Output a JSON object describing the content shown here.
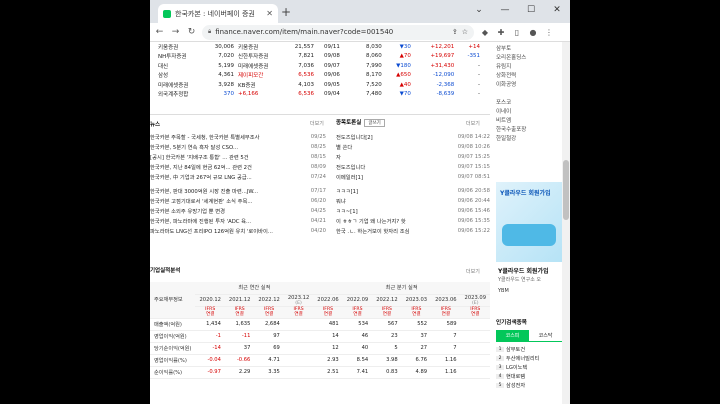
{
  "browser": {
    "tab_title": "한국카본 : 네이버페이 증권",
    "url": "finance.naver.com/item/main.naver?code=001540"
  },
  "quote_table": [
    [
      "키움증권",
      "30,006",
      "키움증권",
      "21,557"
    ],
    [
      "NH투자증권",
      "7,020",
      "신한투자증권",
      "7,821"
    ],
    [
      "대신",
      "5,199",
      "미래에셋증권",
      "7,036"
    ],
    [
      "삼성",
      "4,361",
      "제이피모간",
      "6,536"
    ],
    [
      "미래에셋증권",
      "3,928",
      "KB증권",
      "4,103"
    ],
    [
      "외국계추정합",
      "370",
      "+6,166",
      "6,536"
    ]
  ],
  "daily_table": [
    [
      "09/11",
      "8,030",
      "▼30",
      "+12,201",
      "+14"
    ],
    [
      "09/08",
      "8,060",
      "▲70",
      "+19,697",
      "-351"
    ],
    [
      "09/07",
      "7,990",
      "▼180",
      "+31,430",
      "-"
    ],
    [
      "09/06",
      "8,170",
      "▲650",
      "-12,090",
      "-"
    ],
    [
      "09/05",
      "7,520",
      "▲40",
      "-2,368",
      "-"
    ],
    [
      "09/04",
      "7,480",
      "▼70",
      "-8,639",
      "-"
    ]
  ],
  "news": {
    "title": "뉴스",
    "more": "더보기",
    "items": [
      {
        "t": "한국카본 주목할 - 국세청, 한국카본 특별세무조사",
        "d": "09/25"
      },
      {
        "t": "한국카본, 5분기 연속 흑자 달성 CSO...",
        "d": "08/25"
      },
      {
        "t": "[공시] 한국카본 '지배구조 통합' ... 관련 5건",
        "d": "08/15"
      },
      {
        "t": "한국카본, 지난 84일에 현금 62억... 관련 2건",
        "d": "08/09"
      },
      {
        "t": "한국카본, 中 기업과 267억 규모 LNG 공급...",
        "d": "07/24"
      },
      {
        "t": "한국카본, 판대 3000억원 시장 진출 마련...JW...",
        "d": "07/17"
      },
      {
        "t": "한국카본 고점기대로서 '세계현판' 소식 주목...",
        "d": "06/20"
      },
      {
        "t": "한국카본 소외주 유망기업 뿐 변경",
        "d": "04/25"
      },
      {
        "t": "한국카본, 파노라마에 진행된 투자 'ADC 육...",
        "d": "04/21"
      },
      {
        "t": "파노라마도 LNG선 프리IPO 126억원 유치 '로이바이...",
        "d": "04/20"
      }
    ]
  },
  "board": {
    "title": "종목토론실",
    "write": "글쓰기",
    "more": "더보기",
    "items": [
      {
        "t": "전도즈입니다[2]",
        "d": "09/08 14:22"
      },
      {
        "t": "별 쏜다",
        "d": "09/08 10:26"
      },
      {
        "t": "자",
        "d": "09/07 15:25"
      },
      {
        "t": "전도즈입니다",
        "d": "09/07 15:15"
      },
      {
        "t": "이메일러[1]",
        "d": "09/07 08:51"
      },
      {
        "t": "ㅋㅋㅋ[1]",
        "d": "09/06 20:58"
      },
      {
        "t": "뭐냐",
        "d": "09/06 20:44"
      },
      {
        "t": "ㅋㅋ~[1]",
        "d": "09/06 15:46"
      },
      {
        "t": "이 ㅎㅎㄱ 기업 왜 나는거지? 핫",
        "d": "09/06 15:35"
      },
      {
        "t": "한국 .ㄴ. 하는거보이 핫자리 조심",
        "d": "09/06 15:22"
      }
    ]
  },
  "financials": {
    "title": "기업실적분석",
    "more": "더보기",
    "main_indicator": "주요재무정보",
    "annual_label": "최근 연간 실적",
    "quarter_label": "최근 분기 실적",
    "periods": [
      "2020.12",
      "2021.12",
      "2022.12",
      "2023.12",
      "2022.06",
      "2022.09",
      "2022.12",
      "2023.03",
      "2023.06",
      "2023.09"
    ],
    "estimate": "(E)",
    "ifrs": "IFRS",
    "basis": "연결",
    "rows": [
      {
        "label": "매출액(억원)",
        "values": [
          "1,434",
          "1,635",
          "2,684",
          "",
          "481",
          "534",
          "567",
          "552",
          "589",
          ""
        ],
        "neg": []
      },
      {
        "label": "영업이익(억원)",
        "values": [
          "-1",
          "-11",
          "97",
          "",
          "14",
          "46",
          "23",
          "37",
          "7",
          ""
        ],
        "neg": [
          0,
          1
        ]
      },
      {
        "label": "당기순이익(억원)",
        "values": [
          "-14",
          "37",
          "69",
          "",
          "12",
          "40",
          "5",
          "27",
          "7",
          ""
        ],
        "neg": [
          0
        ]
      },
      {
        "label": "영업이익률(%)",
        "values": [
          "-0.04",
          "-0.66",
          "4.71",
          "",
          "2.93",
          "8.54",
          "3.98",
          "6.76",
          "1.16",
          ""
        ],
        "neg": [
          0,
          1
        ]
      },
      {
        "label": "순이익률(%)",
        "values": [
          "-0.97",
          "2.29",
          "3.35",
          "",
          "2.51",
          "7.41",
          "0.83",
          "4.89",
          "1.16",
          ""
        ],
        "neg": [
          0
        ]
      }
    ]
  },
  "sidebar": {
    "items": [
      "삼부토",
      "오리온홀딩스",
      "유림지",
      "상화전력",
      "이화공영",
      "",
      "포스코",
      "이네이",
      "비트엠",
      "한국수출포장",
      "한일철강"
    ],
    "ad": {
      "headline": "Y클라우드 회원가입",
      "caption": "Y클라우드 회원가입",
      "sub": "Y클라우드 연구소 오",
      "brand": "YBM"
    },
    "popular": {
      "title": "인기검색종목",
      "tabs": [
        "코스피",
        "코스닥"
      ],
      "items": [
        "삼부토건",
        "두산에너빌리티",
        "LG이노텍",
        "현대로템",
        "삼성전자"
      ]
    }
  }
}
